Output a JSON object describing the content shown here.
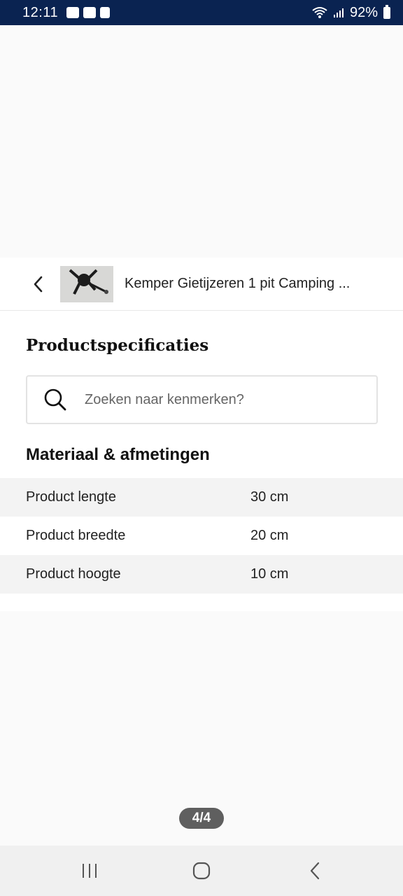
{
  "status_bar": {
    "time": "12:11",
    "battery": "92%",
    "notification_icons": [
      "gallery-icon",
      "mail-icon",
      "flipboard-icon"
    ],
    "background_color": "#0a2351"
  },
  "product": {
    "title": "Kemper Gietijzeren 1 pit Camping ...",
    "thumbnail": "product-image"
  },
  "specs": {
    "heading": "Productspecificaties",
    "search": {
      "placeholder": "Zoeken naar kenmerken?",
      "value": ""
    },
    "group_title": "Materiaal & afmetingen",
    "rows": [
      {
        "label": "Product lengte",
        "value": "30 cm"
      },
      {
        "label": "Product breedte",
        "value": "20 cm"
      },
      {
        "label": "Product hoogte",
        "value": "10 cm"
      }
    ]
  },
  "pager": {
    "label": "4/4"
  },
  "nav": [
    "recent-apps-icon",
    "home-icon",
    "back-icon"
  ]
}
